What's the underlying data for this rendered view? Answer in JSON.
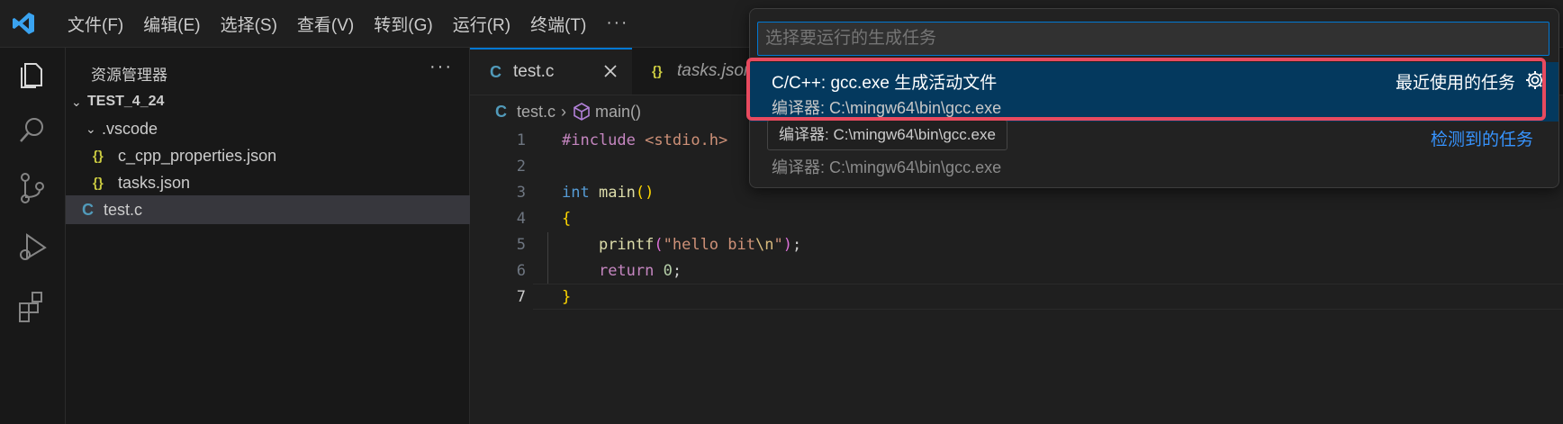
{
  "menu": {
    "items": [
      "文件(F)",
      "编辑(E)",
      "选择(S)",
      "查看(V)",
      "转到(G)",
      "运行(R)",
      "终端(T)"
    ],
    "more": "···"
  },
  "sidebar": {
    "title": "资源管理器",
    "more": "···",
    "root": "TEST_4_24",
    "vscode_folder": ".vscode",
    "files": {
      "c_cpp_properties": "c_cpp_properties.json",
      "tasks": "tasks.json",
      "test_c": "test.c"
    },
    "json_glyph": "{}",
    "c_glyph": "C"
  },
  "tabs": [
    {
      "label": "test.c",
      "icon": "C",
      "active": true
    },
    {
      "label": "tasks.json",
      "icon": "{}",
      "active": false
    }
  ],
  "breadcrumb": {
    "file": "test.c",
    "symbol": "main()"
  },
  "code": {
    "line_numbers": [
      "1",
      "2",
      "3",
      "4",
      "5",
      "6",
      "7"
    ],
    "current_line": 7
  },
  "quickpick": {
    "placeholder": "选择要运行的生成任务",
    "selected_label": "C/C++: gcc.exe 生成活动文件",
    "selected_detail": "编译器: C:\\mingw64\\bin\\gcc.exe",
    "recent_label": "最近使用的任务",
    "detected_label": "检测到的任务",
    "second_detail": "编译器: C:\\mingw64\\bin\\gcc.exe"
  },
  "tooltip": {
    "text": "编译器: C:\\mingw64\\bin\\gcc.exe"
  },
  "colors": {
    "accent": "#0078d4",
    "selection": "#04395e",
    "highlight_box": "#e84a5f",
    "link": "#3794ff"
  },
  "icons": [
    "vscode-logo-icon",
    "explorer-icon",
    "search-icon",
    "source-control-icon",
    "run-debug-icon",
    "extensions-icon",
    "gear-icon",
    "close-icon",
    "chevron-down-icon",
    "symbol-method-icon"
  ]
}
